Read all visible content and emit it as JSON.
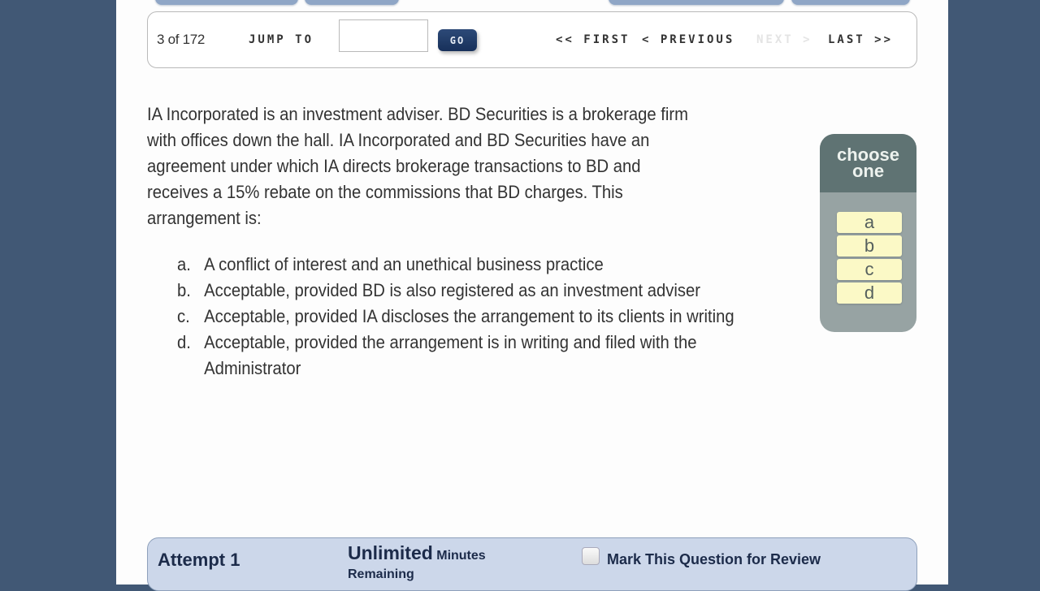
{
  "navigation": {
    "counter": "3 of 172",
    "jump_label": "JUMP TO",
    "jump_input_value": "",
    "go_label": "GO",
    "first_label": "<< FIRST",
    "previous_label": "< PREVIOUS",
    "next_label": "NEXT >",
    "next_enabled": false,
    "last_label": "LAST >>"
  },
  "question": {
    "stem": "IA Incorporated is an investment adviser. BD Securities is a brokerage firm with offices down the hall. IA Incorporated and BD Securities have an agreement under which IA directs brokerage transactions to BD and receives a 15% rebate on the commissions that BD charges. This arrangement is:",
    "options": [
      {
        "letter": "a.",
        "text": "A conflict of interest and an unethical business practice"
      },
      {
        "letter": "b.",
        "text": "Acceptable, provided BD is also registered as an investment adviser"
      },
      {
        "letter": "c.",
        "text": "Acceptable, provided IA discloses the arrangement to its clients in writing"
      },
      {
        "letter": "d.",
        "text": "Acceptable, provided the arrangement is in writing and filed with the Administrator"
      }
    ]
  },
  "answer_panel": {
    "title_line1": "choose",
    "title_line2": "one",
    "choices": [
      "a",
      "b",
      "c",
      "d"
    ]
  },
  "footer": {
    "attempt": "Attempt 1",
    "time_value": "Unlimited",
    "time_unit": "Minutes",
    "time_suffix": "Remaining",
    "review_label": "Mark This Question for Review",
    "review_checked": false
  },
  "colors": {
    "background": "#415875",
    "go_button": "#1f3a66",
    "choose_header": "#5f7373",
    "choice_button": "#fbf9c6",
    "footer_bar": "#ccd7ea"
  }
}
